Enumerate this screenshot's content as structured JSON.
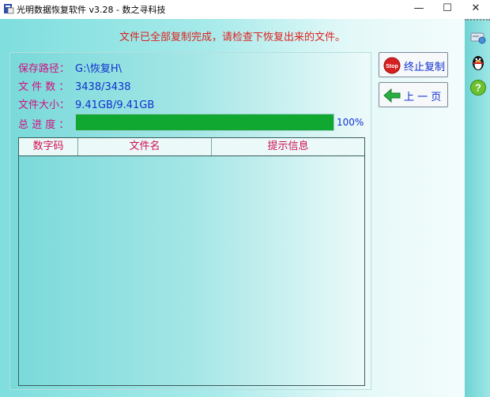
{
  "window": {
    "title": "光明数据恢复软件 v3.28 - 数之寻科技",
    "minimize": "—",
    "maximize": "☐",
    "close": "✕"
  },
  "status_message": "文件已全部复制完成，请检查下恢复出来的文件。",
  "info": {
    "save_path_label": "保存路径：",
    "save_path_value": "G:\\恢复H\\",
    "file_count_label": "文 件 数 ：",
    "file_count_value": "3438/3438",
    "file_size_label": "文件大小：",
    "file_size_value": "9.41GB/9.41GB",
    "progress_label": "总 进 度 ：",
    "progress_value": 1.0,
    "progress_text": "100%"
  },
  "table": {
    "columns": [
      "数字码",
      "文件名",
      "提示信息"
    ],
    "rows": []
  },
  "buttons": {
    "stop_copy": "终止复制",
    "stop_icon_text": "Stop",
    "previous_page": "上 一 页"
  },
  "icons": {
    "app": "app-icon",
    "stop": "stop-sign-icon",
    "back": "green-left-arrow-icon",
    "side": [
      "network-drive-icon",
      "qq-penguin-icon",
      "help-icon"
    ]
  },
  "colors": {
    "status_text": "#e02020",
    "label_text": "#d01080",
    "value_text": "#1030d0",
    "progress_fill": "#10a830"
  }
}
